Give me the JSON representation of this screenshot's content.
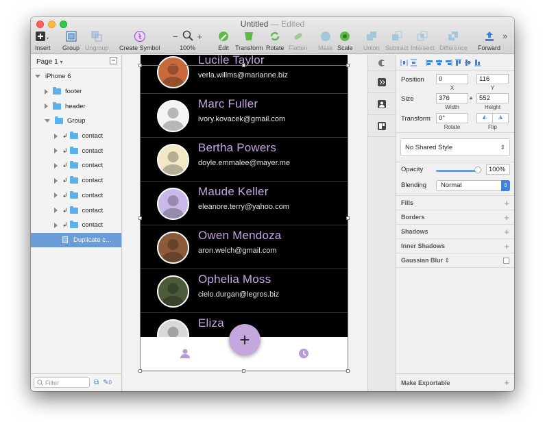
{
  "window": {
    "title": "Untitled",
    "title_suffix": "— Edited"
  },
  "toolbar": {
    "insert": "Insert",
    "group": "Group",
    "ungroup": "Ungroup",
    "create_symbol": "Create Symbol",
    "zoom_minus": "−",
    "zoom_plus": "+",
    "zoom": "100%",
    "edit": "Edit",
    "transform": "Transform",
    "rotate": "Rotate",
    "flatten": "Flatten",
    "mask": "Mask",
    "scale": "Scale",
    "union": "Union",
    "subtract": "Subtract",
    "intersect": "Intersect",
    "difference": "Difference",
    "forward": "Forward",
    "more": "»"
  },
  "sidebar": {
    "page": "Page 1",
    "layers": [
      {
        "label": "iPhone 6",
        "indent": 0,
        "kind": "artboard",
        "expanded": true
      },
      {
        "label": "footer",
        "indent": 1,
        "kind": "folder",
        "expanded": false
      },
      {
        "label": "header",
        "indent": 1,
        "kind": "folder",
        "expanded": false
      },
      {
        "label": "Group",
        "indent": 1,
        "kind": "folder",
        "expanded": true
      },
      {
        "label": "contact",
        "indent": 2,
        "kind": "folder-mask",
        "expanded": false
      },
      {
        "label": "contact",
        "indent": 2,
        "kind": "folder-mask",
        "expanded": false
      },
      {
        "label": "contact",
        "indent": 2,
        "kind": "folder-mask",
        "expanded": false
      },
      {
        "label": "contact",
        "indent": 2,
        "kind": "folder-mask",
        "expanded": false
      },
      {
        "label": "contact",
        "indent": 2,
        "kind": "folder-mask",
        "expanded": false
      },
      {
        "label": "contact",
        "indent": 2,
        "kind": "folder-mask",
        "expanded": false
      },
      {
        "label": "contact",
        "indent": 2,
        "kind": "folder-mask",
        "expanded": false
      },
      {
        "label": "Duplicate c...",
        "indent": 2,
        "kind": "page",
        "selected": true
      }
    ],
    "filter_placeholder": "Filter",
    "filter_count": "0"
  },
  "contacts": [
    {
      "name": "Lucile Taylor",
      "email": "verla.willms@marianne.biz",
      "avatar_color": "#c96a3d",
      "avatar_icon": "woman-avatar"
    },
    {
      "name": "Marc Fuller",
      "email": "ivory.kovacek@gmail.com",
      "avatar_color": "#f4f4f4",
      "avatar_icon": "cartoon-man-avatar"
    },
    {
      "name": "Bertha Powers",
      "email": "doyle.emmalee@mayer.me",
      "avatar_color": "#f2e8c6",
      "avatar_icon": "milk-bottles-avatar"
    },
    {
      "name": "Maude Keller",
      "email": "eleanore.terry@yahoo.com",
      "avatar_color": "#c9b8ea",
      "avatar_icon": "blonde-woman-avatar"
    },
    {
      "name": "Owen Mendoza",
      "email": "aron.welch@gmail.com",
      "avatar_color": "#8a5a3a",
      "avatar_icon": "man-avatar"
    },
    {
      "name": "Ophelia Moss",
      "email": "cielo.durgan@legros.biz",
      "avatar_color": "#4d5a3a",
      "avatar_icon": "man-suit-avatar"
    },
    {
      "name": "Eliza",
      "email": "",
      "avatar_color": "#d8d8d8",
      "avatar_icon": "partial-avatar"
    }
  ],
  "app_footer": {
    "fab_label": "+",
    "left_icon": "person-icon",
    "right_icon": "clock-icon",
    "accent": "#c3a7dd"
  },
  "inspector": {
    "position_label": "Position",
    "x": "0",
    "y": "116",
    "x_label": "X",
    "y_label": "Y",
    "size_label": "Size",
    "width": "376",
    "height": "552",
    "width_label": "Width",
    "height_label": "Height",
    "transform_label": "Transform",
    "rotate": "0°",
    "rotate_label": "Rotate",
    "flip_label": "Flip",
    "shared_style": "No Shared Style",
    "opacity_label": "Opacity",
    "opacity": "100%",
    "blending_label": "Blending",
    "blending": "Normal",
    "sections": [
      "Fills",
      "Borders",
      "Shadows",
      "Inner Shadows",
      "Gaussian Blur"
    ],
    "export": "Make Exportable"
  }
}
